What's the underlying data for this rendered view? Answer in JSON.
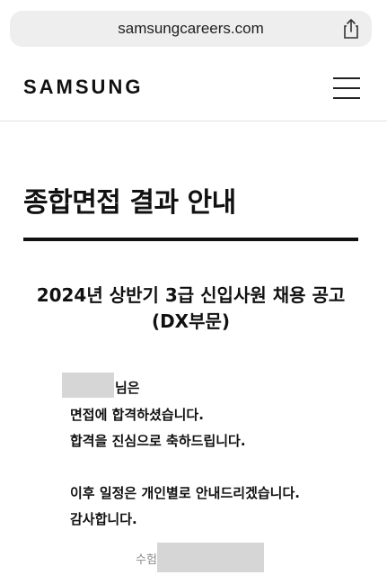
{
  "browser": {
    "url": "samsungcareers.com",
    "share_icon": "share-icon"
  },
  "header": {
    "logo": "SAMSUNG",
    "menu_icon": "hamburger-menu-icon"
  },
  "main": {
    "title": "종합면접 결과 안내",
    "subtitle_line1": "2024년 상반기 3급 신입사원 채용 공고",
    "subtitle_line2": "(DX부문)",
    "name_suffix": "님은",
    "message_line1": "면접에 합격하셨습니다.",
    "message_line2": "합격을 진심으로 축하드립니다.",
    "message_line3": "이후 일정은 개인별로 안내드리겠습니다.",
    "message_line4": "감사합니다.",
    "exam_label": "수험"
  }
}
